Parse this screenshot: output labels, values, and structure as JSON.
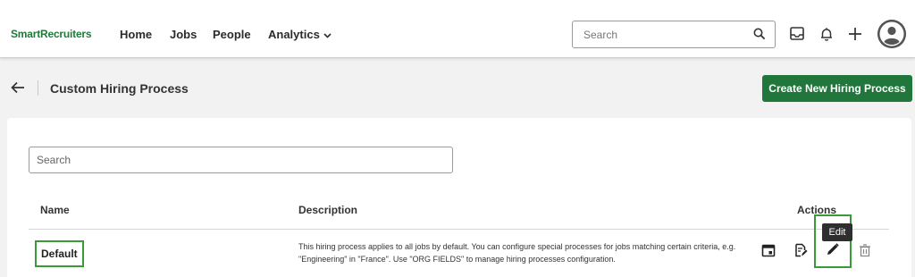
{
  "brand": {
    "part1": "Smart",
    "part2": "Recruiters"
  },
  "nav": {
    "home": "Home",
    "jobs": "Jobs",
    "people": "People",
    "analytics": "Analytics"
  },
  "top_search": {
    "placeholder": "Search"
  },
  "page": {
    "title": "Custom Hiring Process",
    "create_button": "Create New Hiring Process"
  },
  "list_search": {
    "placeholder": "Search"
  },
  "table": {
    "headers": {
      "name": "Name",
      "description": "Description",
      "actions": "Actions"
    },
    "rows": [
      {
        "name": "Default",
        "description": "This hiring process applies to all jobs by default. You can configure special processes for jobs matching certain criteria, e.g. \"Engineering\" in \"France\". Use \"ORG FIELDS\" to manage hiring processes configuration."
      }
    ]
  },
  "tooltip": {
    "edit": "Edit"
  },
  "colors": {
    "brand_green": "#21763c",
    "highlight": "#3a9a3a"
  },
  "icons": [
    "search-icon",
    "inbox-icon",
    "bell-icon",
    "plus-icon",
    "avatar-icon",
    "back-arrow-icon",
    "calendar-icon",
    "document-edit-icon",
    "pencil-icon",
    "trash-icon"
  ]
}
